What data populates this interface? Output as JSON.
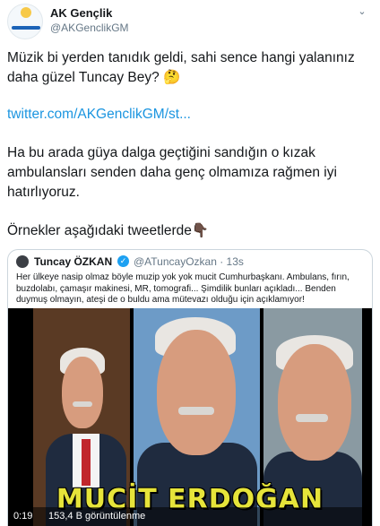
{
  "tweet": {
    "author": {
      "display_name": "AK Gençlik",
      "handle": "@AKGenclikGM",
      "avatar_logo_text": "gençlik kolları"
    },
    "menu_icon": "chevron-down-icon",
    "text_1": "Müzik bi yerden tanıdık geldi, sahi sence hangi yalanınız daha güzel Tuncay Bey? 🤔",
    "link": "twitter.com/AKGenclikGM/st...",
    "text_2": "Ha bu arada güya dalga geçtiğini sandığın o kızak ambulansları senden daha genç olmamıza rağmen iyi hatırlıyoruz.",
    "text_3": "Örnekler aşağıdaki tweetlerde",
    "text_3_emoji": "👇🏿"
  },
  "quoted_tweet": {
    "author_name": "Tuncay ÖZKAN",
    "verified_icon": "verified-badge-icon",
    "handle_and_time": "@ATuncayOzkan · 13s",
    "text": "Her ülkeye nasip olmaz böyle muzip yok yok mucit Cumhurbaşkanı. Ambulans, fırın, buzdolabı, çamaşır makinesi, MR, tomografi... Şimdilik bunları açıkladı... Benden duymuş olmayın, ateşi de o buldu ama mütevazı olduğu için açıklamıyor!",
    "video": {
      "caption": "MUCİT ERDOĞAN",
      "elapsed": "0:19",
      "views": "153,4 B görüntülenme"
    }
  },
  "colors": {
    "link": "#1b95e0",
    "verified": "#1da1f2",
    "caption": "#e6e43a"
  }
}
